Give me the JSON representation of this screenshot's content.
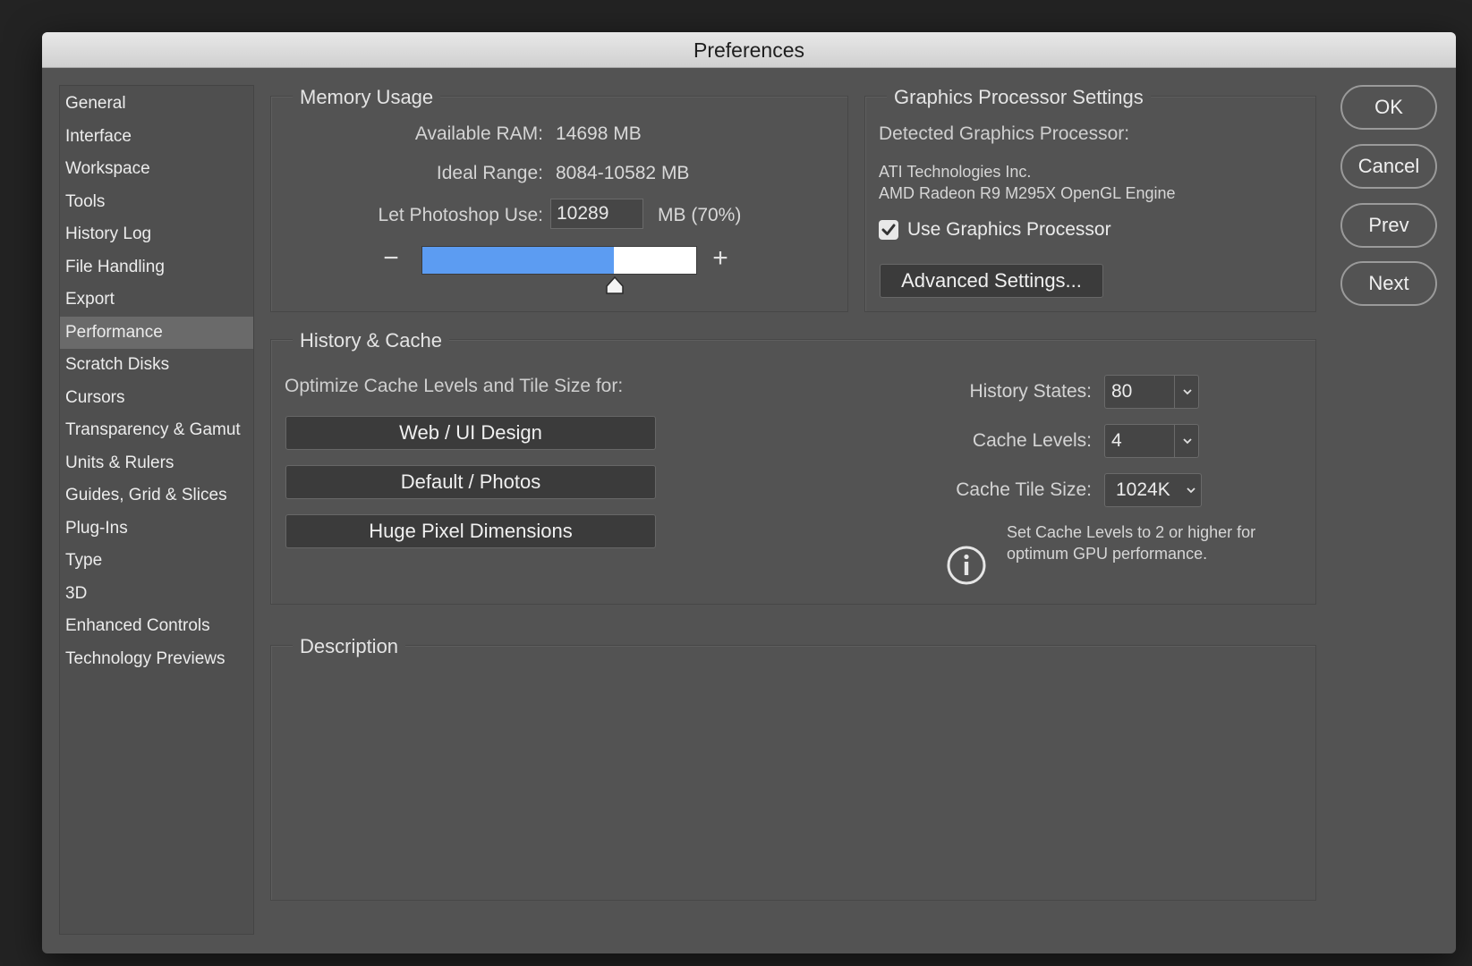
{
  "window": {
    "title": "Preferences"
  },
  "sidebar": {
    "items": [
      {
        "label": "General"
      },
      {
        "label": "Interface"
      },
      {
        "label": "Workspace"
      },
      {
        "label": "Tools"
      },
      {
        "label": "History Log"
      },
      {
        "label": "File Handling"
      },
      {
        "label": "Export"
      },
      {
        "label": "Performance",
        "selected": true
      },
      {
        "label": "Scratch Disks"
      },
      {
        "label": "Cursors"
      },
      {
        "label": "Transparency & Gamut"
      },
      {
        "label": "Units & Rulers"
      },
      {
        "label": "Guides, Grid & Slices"
      },
      {
        "label": "Plug-Ins"
      },
      {
        "label": "Type"
      },
      {
        "label": "3D"
      },
      {
        "label": "Enhanced Controls"
      },
      {
        "label": "Technology Previews"
      }
    ]
  },
  "memory": {
    "title": "Memory Usage",
    "available_label": "Available RAM:",
    "available_value": "14698 MB",
    "ideal_label": "Ideal Range:",
    "ideal_value": "8084-10582 MB",
    "use_label": "Let Photoshop Use:",
    "use_value": "10289",
    "use_suffix": "MB (70%)",
    "decrease_symbol": "−",
    "increase_symbol": "+",
    "slider_fraction": 0.7,
    "slider_color": "#5c9cf2"
  },
  "gpu": {
    "title": "Graphics Processor Settings",
    "detected_label": "Detected Graphics Processor:",
    "vendor": "ATI Technologies Inc.",
    "engine": "AMD Radeon R9 M295X OpenGL Engine",
    "use_gpu_label": "Use Graphics Processor",
    "use_gpu_checked": true,
    "advanced_label": "Advanced Settings..."
  },
  "history_cache": {
    "title": "History & Cache",
    "optimize_label": "Optimize Cache Levels and Tile Size for:",
    "preset_buttons": [
      "Web / UI Design",
      "Default / Photos",
      "Huge Pixel Dimensions"
    ],
    "history_states_label": "History States:",
    "history_states_value": "80",
    "cache_levels_label": "Cache Levels:",
    "cache_levels_value": "4",
    "tile_size_label": "Cache Tile Size:",
    "tile_size_value": "1024K",
    "info_text_line1": "Set Cache Levels to 2 or higher for",
    "info_text_line2": "optimum GPU performance.",
    "info_icon": "info-icon"
  },
  "description": {
    "title": "Description"
  },
  "actions": {
    "ok": "OK",
    "cancel": "Cancel",
    "prev": "Prev",
    "next": "Next"
  }
}
